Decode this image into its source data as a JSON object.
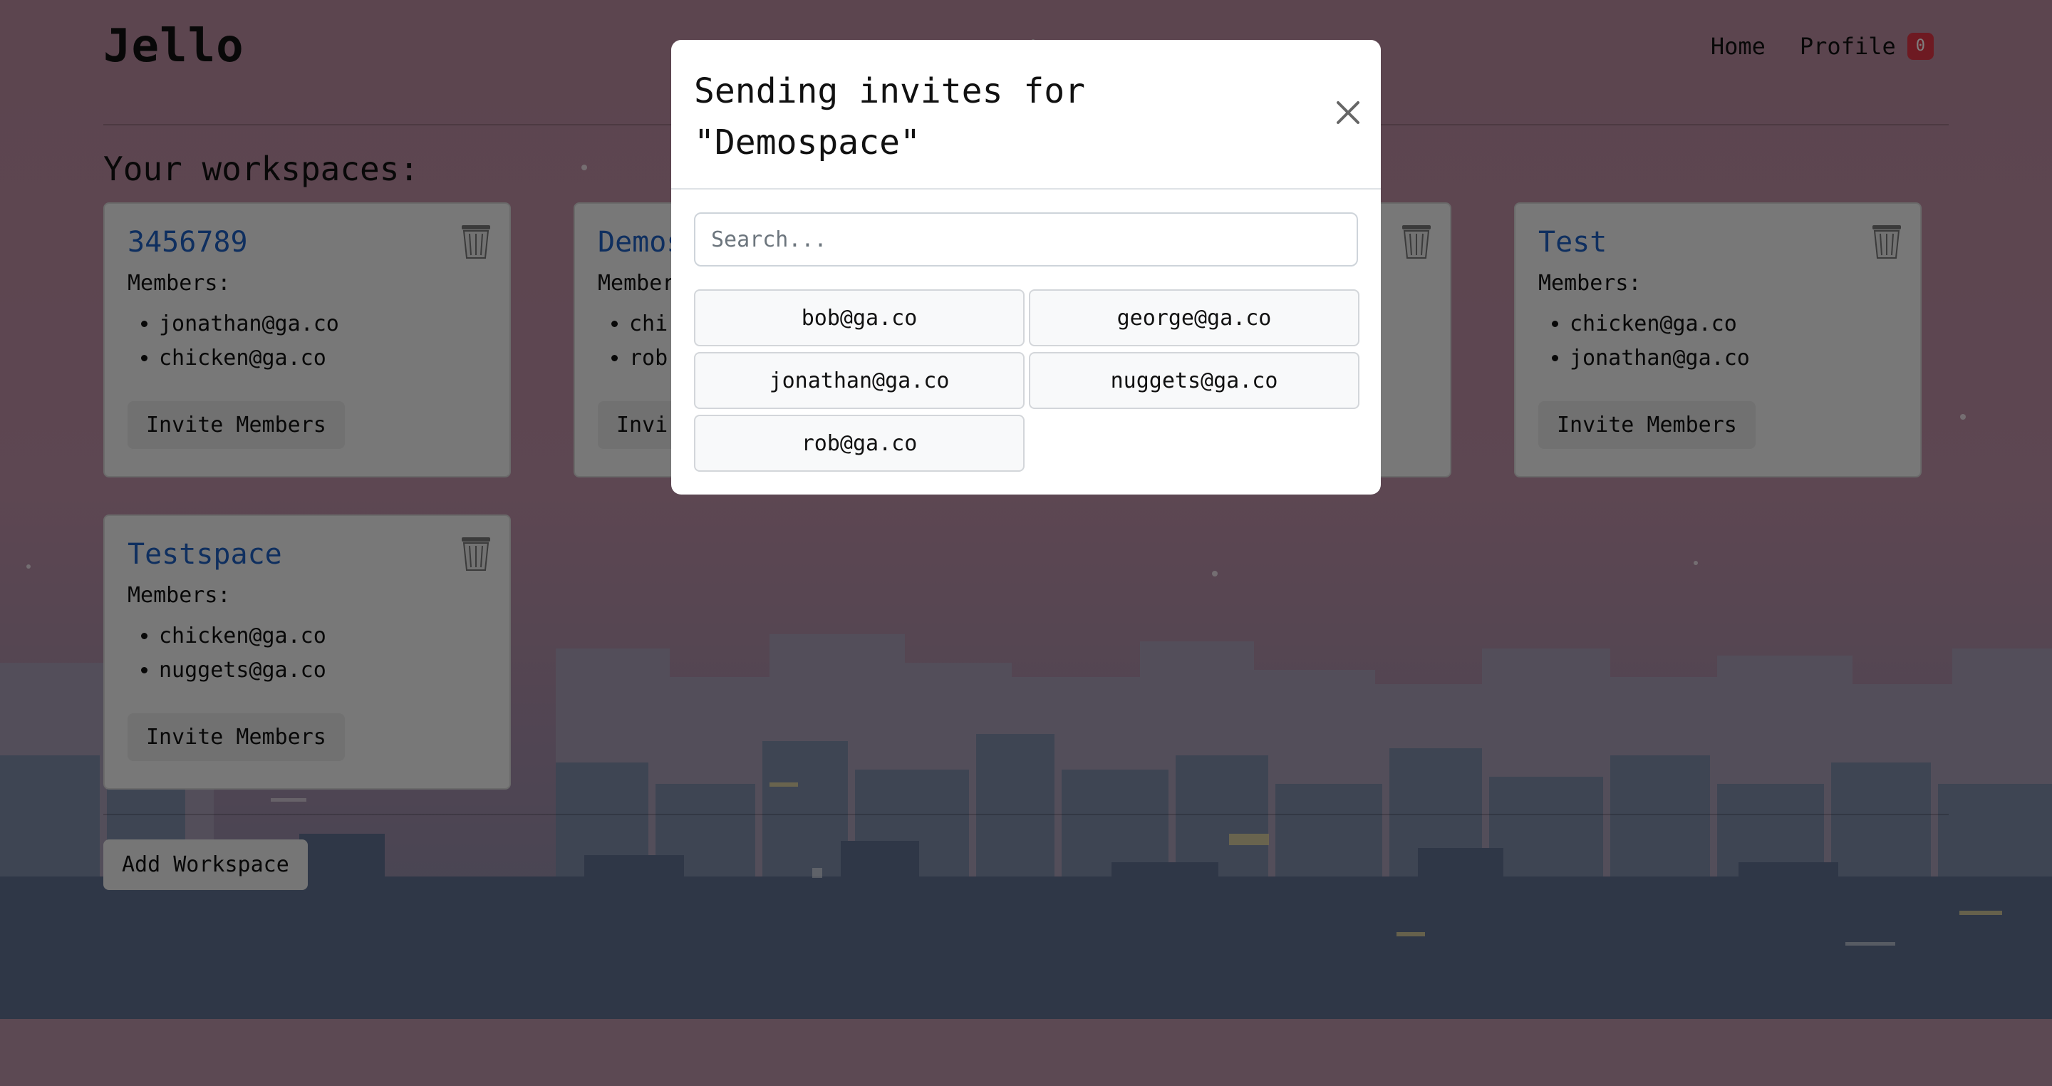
{
  "app": {
    "brand": "Jello"
  },
  "nav": {
    "home": "Home",
    "profile": "Profile",
    "notification_count": "0"
  },
  "heading": "Your workspaces:",
  "workspaces": [
    {
      "name": "3456789",
      "members_label": "Members:",
      "members": [
        "jonathan@ga.co",
        "chicken@ga.co"
      ],
      "invite_label": "Invite Members"
    },
    {
      "name": "Demos",
      "members_label": "Member",
      "members": [
        "chi",
        "rob"
      ],
      "invite_label": "Invi"
    },
    {
      "name": "Test",
      "members_label": "Members:",
      "members": [
        "chicken@ga.co",
        "jonathan@ga.co"
      ],
      "invite_label": "Invite Members"
    },
    {
      "name": "Testspace",
      "members_label": "Members:",
      "members": [
        "chicken@ga.co",
        "nuggets@ga.co"
      ],
      "invite_label": "Invite Members"
    }
  ],
  "add_workspace_label": "Add Workspace",
  "modal": {
    "title": "Sending invites for \"Demospace\"",
    "search_placeholder": "Search...",
    "users": [
      "bob@ga.co",
      "george@ga.co",
      "jonathan@ga.co",
      "nuggets@ga.co",
      "rob@ga.co"
    ]
  },
  "icons": {
    "delete": "trash-icon",
    "close": "close-icon"
  },
  "colors": {
    "workspace_title": "#1f5fbf",
    "badge": "#dc3545"
  }
}
